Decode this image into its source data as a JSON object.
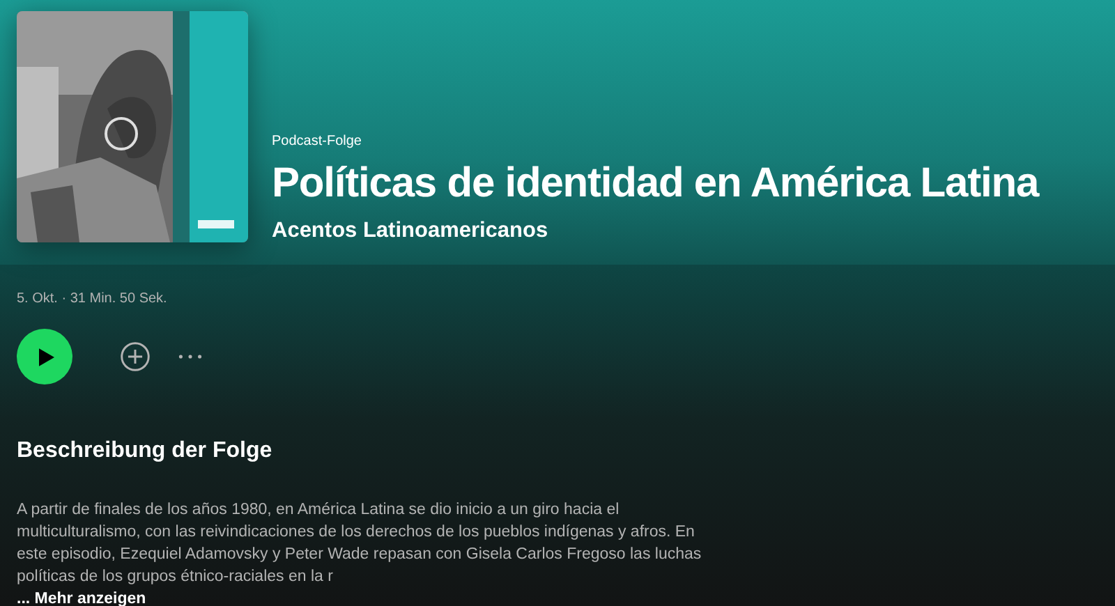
{
  "episode": {
    "type_label": "Podcast-Folge",
    "title": "Políticas de identidad en América Latina",
    "show": "Acentos Latinoamericanos"
  },
  "meta": "5. Okt. · 31 Min. 50 Sek.",
  "description": {
    "heading": "Beschreibung der Folge",
    "text": "A partir de finales de los años 1980, en América Latina se dio inicio a un giro hacia el multiculturalismo, con las reivindicaciones de los derechos de los pueblos indígenas y afros. En este episodio, Ezequiel Adamovsky y Peter Wade repasan con Gisela Carlos Fregoso las luchas políticas de los grupos étnico-raciales en la r",
    "more": "... Mehr anzeigen"
  }
}
